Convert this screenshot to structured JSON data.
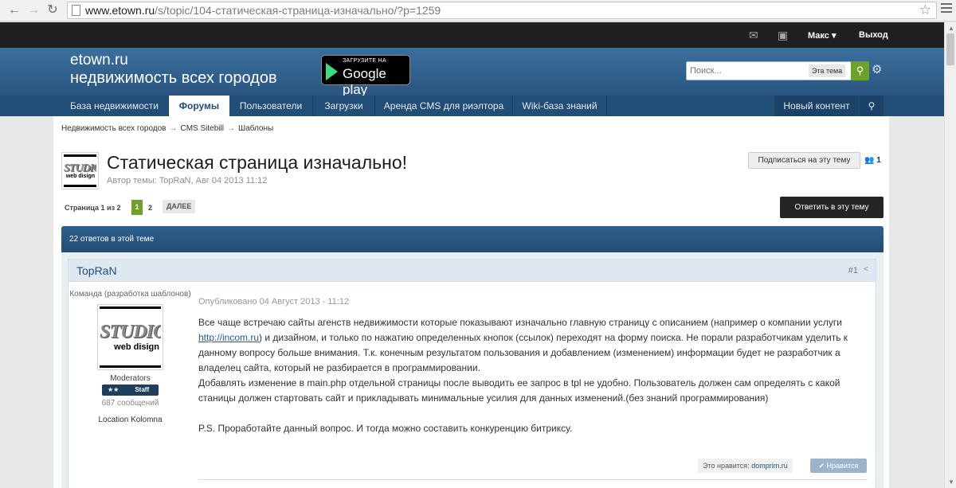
{
  "browser": {
    "url_host": "www.etown.ru",
    "url_path": "/s/topic/104-статическая-страница-изначально/?p=1259"
  },
  "userbar": {
    "user_name": "Макс",
    "logout_label": "Выход"
  },
  "header": {
    "logo_line1": "etown.ru",
    "logo_line2": "недвижимость всех городов",
    "gplay_small": "ЗАГРУЗИТЕ НА",
    "gplay_big": "Google play",
    "search_placeholder": "Поиск...",
    "search_scope": "Эта тема"
  },
  "nav": {
    "items": [
      "База недвижимости",
      "Форумы",
      "Пользователи",
      "Загрузки",
      "Аренда CMS для риэлтора",
      "Wiki-база знаний"
    ],
    "active_index": 1,
    "new_content": "Новый контент"
  },
  "breadcrumb": [
    "Недвижимость всех городов",
    "CMS Sitebill",
    "Шаблоны"
  ],
  "topic": {
    "title": "Статическая страница изначально!",
    "meta": "Автор темы: TopRaN, Авг 04 2013 11:12",
    "follow_label": "Подписаться на эту тему",
    "follow_count": "1",
    "page_label": "Страница 1 из 2",
    "page_current": "1",
    "page_two": "2",
    "page_next": "ДАЛЕЕ",
    "reply_label": "Ответить в эту тему",
    "replies_header": "22 ответов в этой теме"
  },
  "post": {
    "author": "TopRaN",
    "number": "#1",
    "author_group": "Команда (разработка шаблонов)",
    "avatar_text": "STUDIO",
    "avatar_sub": "web disign",
    "author_rank": "Moderators",
    "staff_stars": "★★",
    "staff_label": "Staff",
    "author_posts": "687 сообщений",
    "author_location_label": "Location",
    "author_location": "Kolomna",
    "date": "Опубликовано 04 Август 2013 - 11:12",
    "p1_a": "Все чаще встречаю сайты агенств недвижимости которые показывают изначально главную страницу с описанием (например о компании услуги ",
    "p1_link": "http://incom.ru",
    "p1_b": ") и дизайном, и только по нажатию определенных кнопок (ссылок) переходят на форму поиска. Не порали разработчикам уделить к данному вопросу больше внимания. Т.к. конечным результатом пользования и добавлением (изменением) информации будет не разработчик а владелец сайта, который не разбирается в программировании.",
    "p2": "Добавлять изменение в main.php отдельной страницы после выводить ее запрос в tpl не удобно. Пользователь должен сам определять с какой станицы должен стартовать сайт и прикладывать минимальные усилия для данных изменений.(без знаний программирования)",
    "p3": "P.S. Проработайте данный вопрос. И тогда можно составить  конкуренцию битриксу.",
    "likes_label": "Это нравится:",
    "likes_who": "domprim.ru",
    "like_button": "Нравится"
  }
}
